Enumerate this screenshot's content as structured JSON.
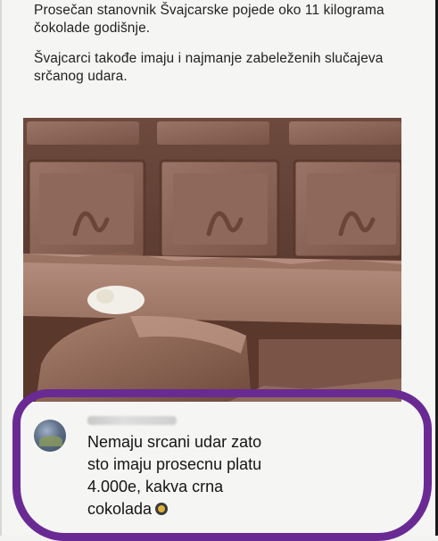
{
  "post": {
    "paragraphs": [
      "Prosečan stanovnik Švajcarske pojede oko 11 kilograma čokolade godišnje.",
      "Švajcarci takođe imaju i najmanje zabeleženih slučajeva srčanog udara."
    ]
  },
  "comment": {
    "lines": [
      "Nemaju srcani udar zato",
      "sto imaju prosecnu platu",
      "4.000e, kakva crna",
      "cokolada"
    ],
    "emoji": "laughing-emoji"
  },
  "colors": {
    "highlight_circle": "#6a2a93",
    "chocolate": "#7a5446"
  }
}
